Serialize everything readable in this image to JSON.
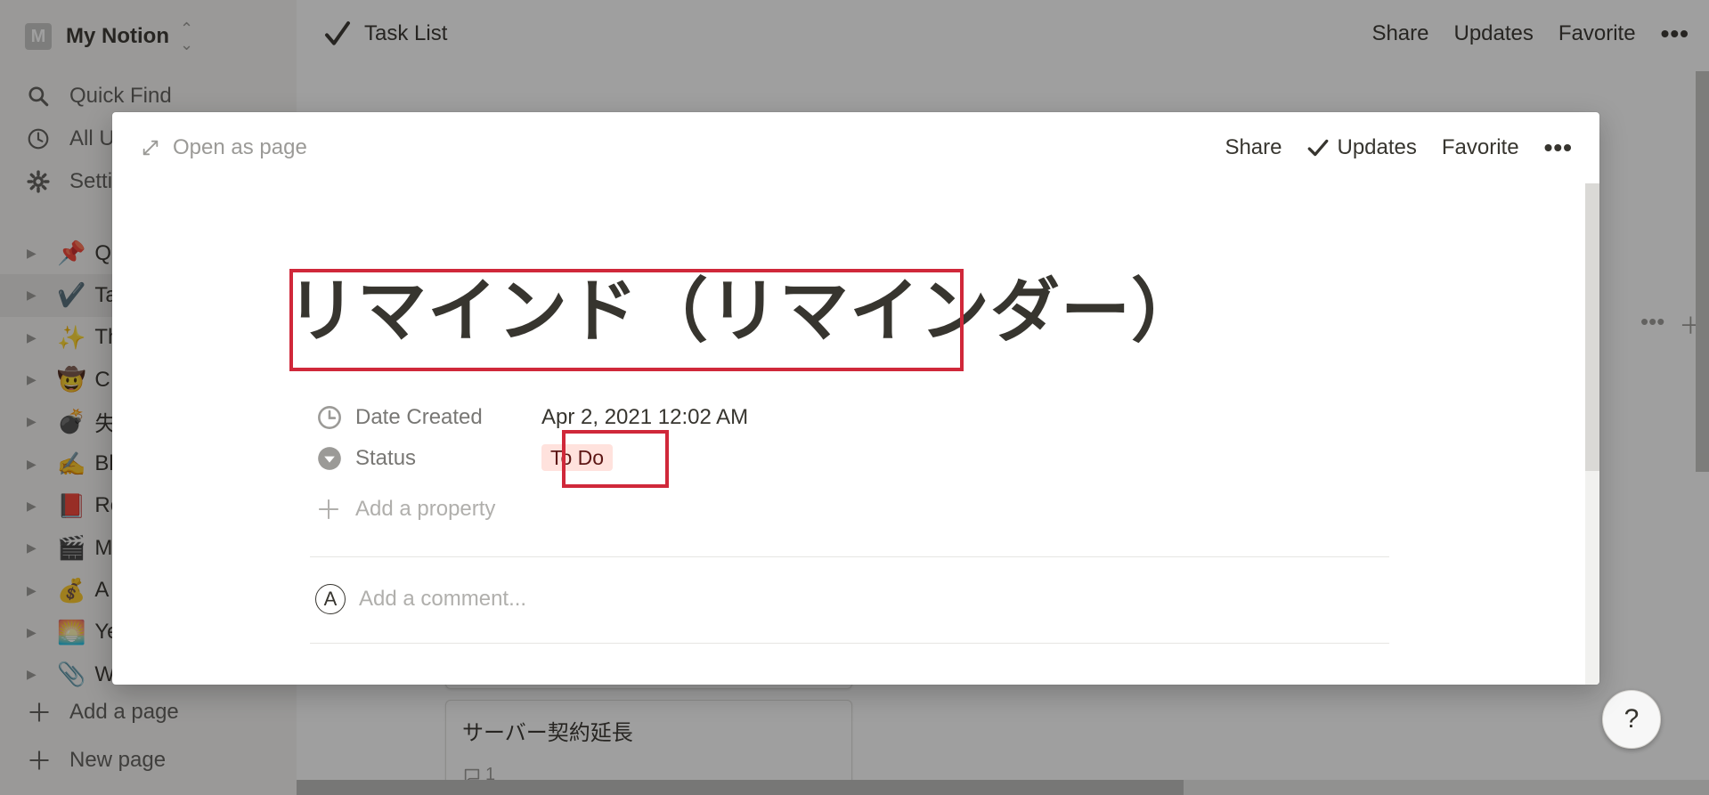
{
  "workspace": {
    "avatar_letter": "M",
    "name": "My Notion"
  },
  "sidebar": {
    "nav": [
      "Quick Find",
      "All Updates",
      "Settings & Members"
    ],
    "pages": [
      {
        "emoji": "📌",
        "label": "Q"
      },
      {
        "emoji": "✔️",
        "label": "Ta"
      },
      {
        "emoji": "✨",
        "label": "Th"
      },
      {
        "emoji": "🤠",
        "label": "C"
      },
      {
        "emoji": "💣",
        "label": "失"
      },
      {
        "emoji": "✍️",
        "label": "Bl"
      },
      {
        "emoji": "📕",
        "label": "Re"
      },
      {
        "emoji": "🎬",
        "label": "M"
      },
      {
        "emoji": "💰",
        "label": "A"
      },
      {
        "emoji": "🌅",
        "label": "Ye"
      },
      {
        "emoji": "📎",
        "label": "W"
      }
    ],
    "add_page": "Add a page",
    "new_page": "New page"
  },
  "topbar": {
    "title": "Task List",
    "share": "Share",
    "updates": "Updates",
    "favorite": "Favorite"
  },
  "board": {
    "card_title": "サーバー契約延長",
    "card_comment_count": "1"
  },
  "help": {
    "label": "?"
  },
  "modal": {
    "open_as_page": "Open as page",
    "share": "Share",
    "updates": "Updates",
    "favorite": "Favorite",
    "title": "リマインド（リマインダー）",
    "properties": {
      "date_created_label": "Date Created",
      "date_created_value": "Apr 2, 2021 12:02 AM",
      "status_label": "Status",
      "status_value": "To Do"
    },
    "add_property": "Add a property",
    "comment_avatar": "A",
    "comment_placeholder": "Add a comment..."
  },
  "colors": {
    "highlight": "#d0283a",
    "status_tag_bg": "#ffe2dd",
    "text": "#37352f"
  }
}
